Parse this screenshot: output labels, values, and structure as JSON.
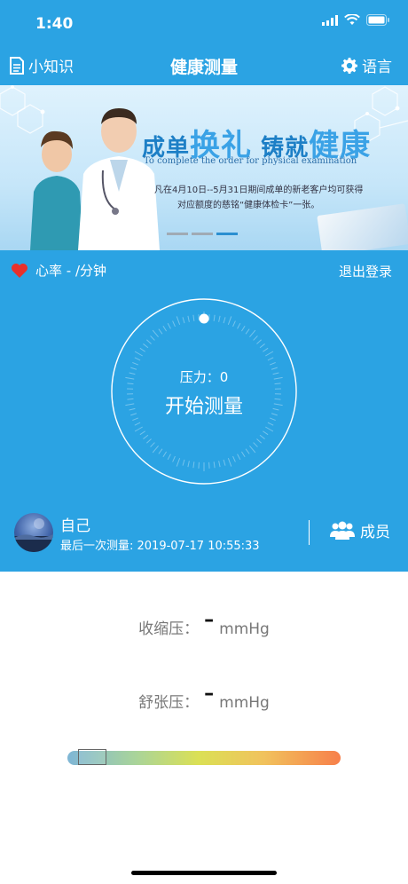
{
  "status_bar": {
    "time": "1:40"
  },
  "nav": {
    "left_label": "小知识",
    "title": "健康测量",
    "right_label": "语言"
  },
  "banner": {
    "title_part1": "成单",
    "title_part2": "换礼",
    "title_part3": " 铸就",
    "title_part4": "健康",
    "subtitle": "To complete the order for physical examination",
    "line1": "凡在4月10日--5月31日期间成单的新老客户均可获得",
    "line2": "对应额度的慈铭“健康体检卡”一张。"
  },
  "heart_rate": {
    "label": "心率 - /分钟"
  },
  "logout_label": "退出登录",
  "measure": {
    "pressure_label": "压力：0",
    "start_label": "开始测量"
  },
  "user": {
    "name": "自己",
    "last_measure": "最后一次测量: 2019-07-17 10:55:33"
  },
  "members_label": "成员",
  "readings": {
    "systolic_label": "收缩压：",
    "systolic_value": "–",
    "diastolic_label": "舒张压：",
    "diastolic_value": "–",
    "unit": "mmHg"
  },
  "gauge": {
    "level": 0.07
  },
  "colors": {
    "primary": "#2ba3e3",
    "heart": "#e8312b"
  }
}
